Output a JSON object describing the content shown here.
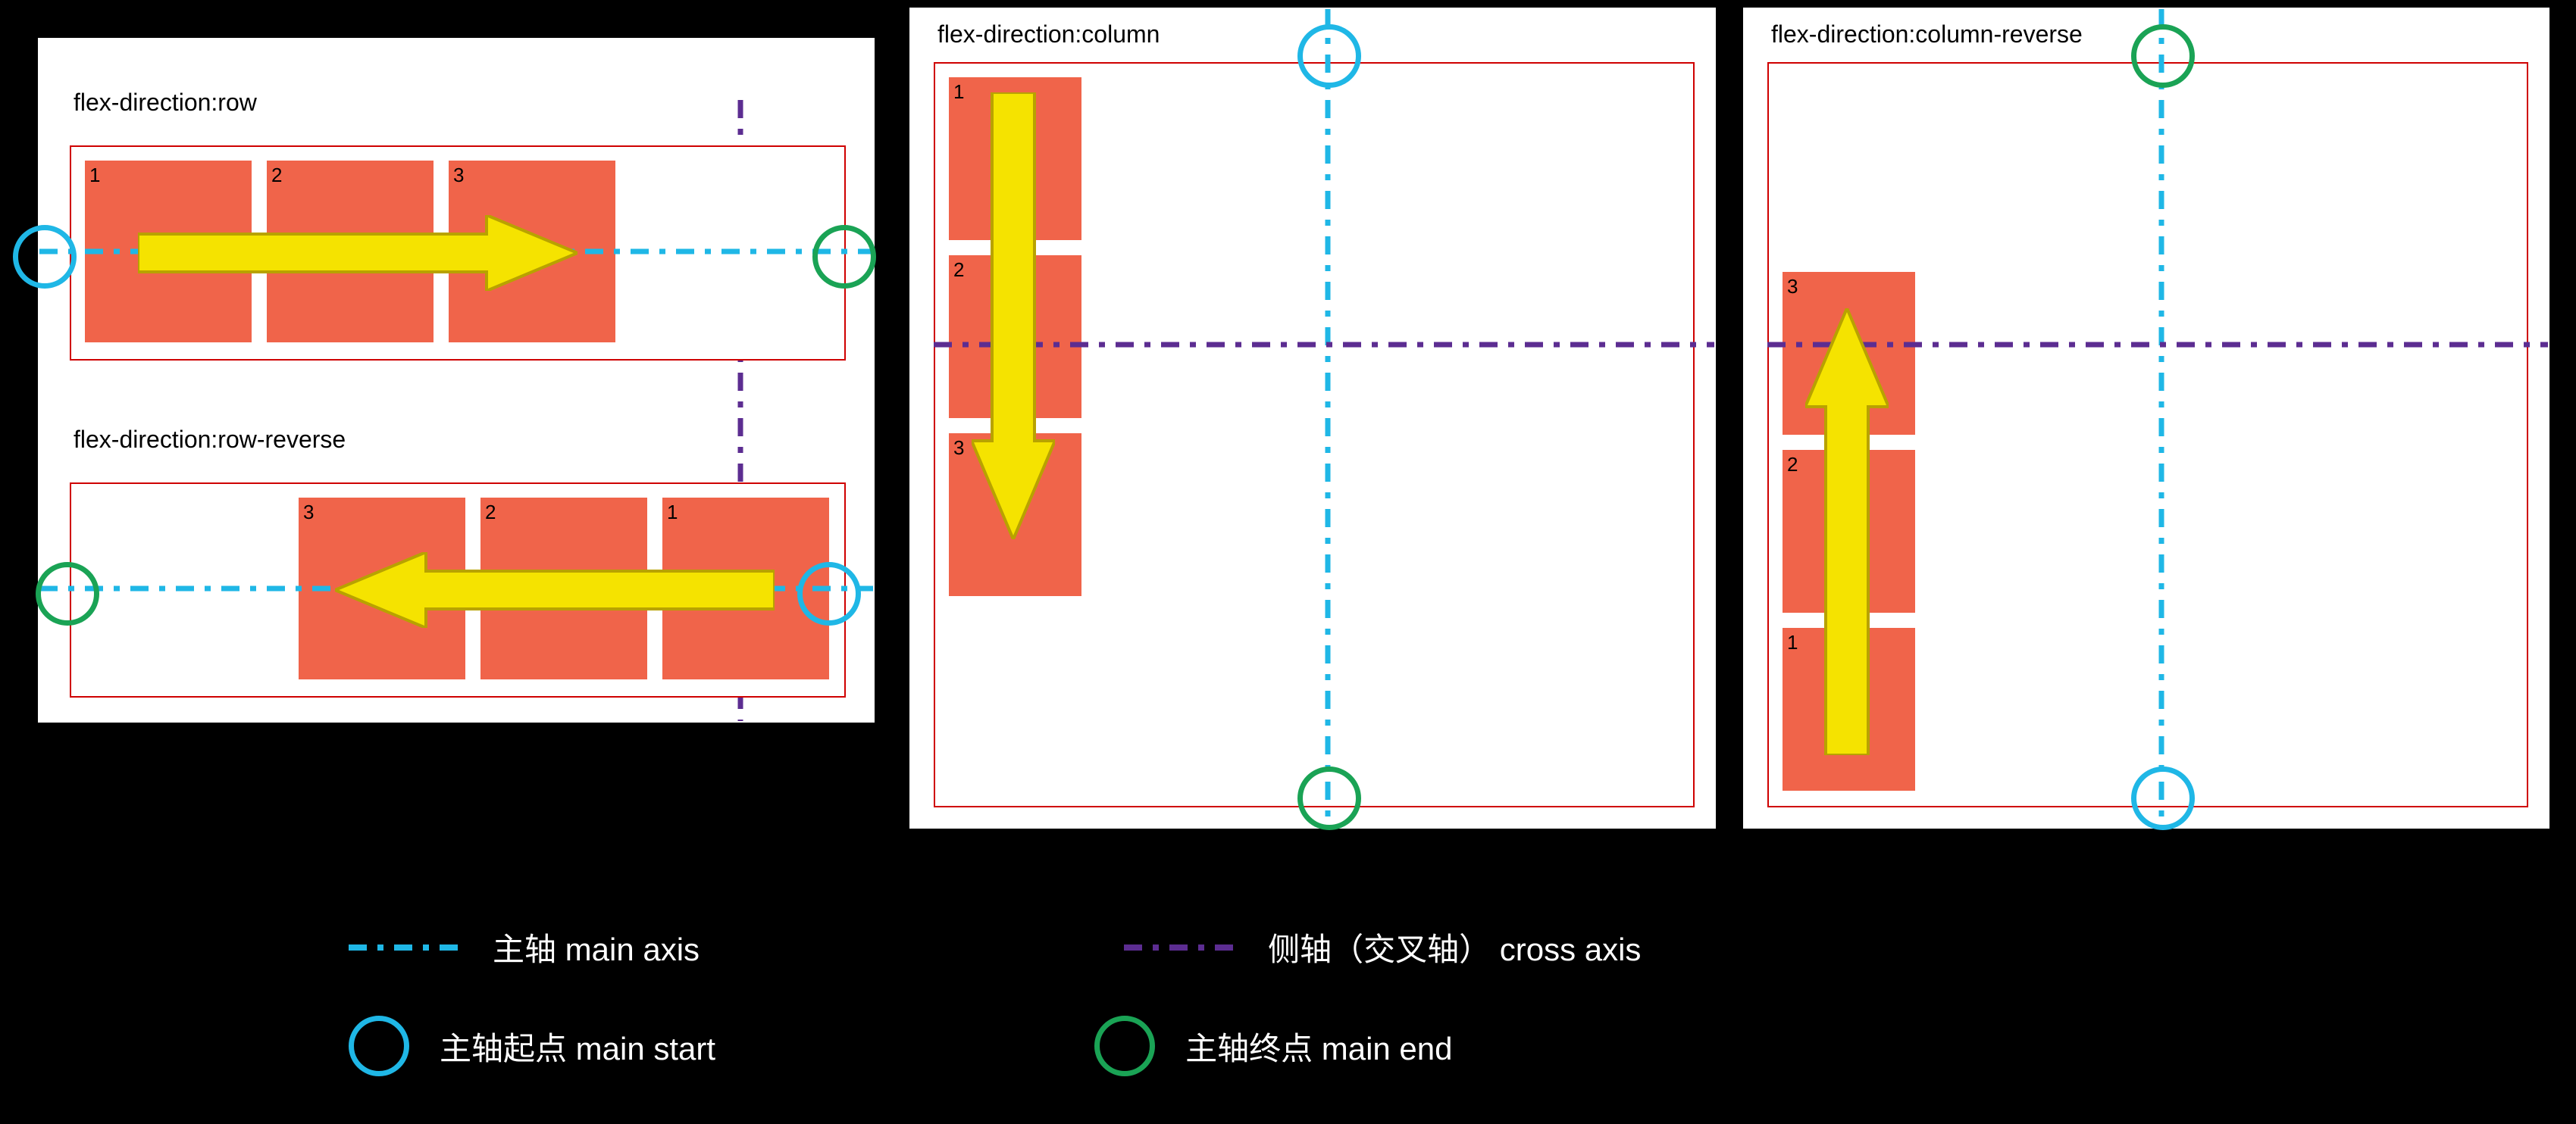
{
  "panels": {
    "rowPair": {
      "row": {
        "title": "flex-direction:row",
        "items": [
          "1",
          "2",
          "3"
        ]
      },
      "rowReverse": {
        "title": "flex-direction:row-reverse",
        "items": [
          "1",
          "2",
          "3"
        ]
      }
    },
    "column": {
      "title": "flex-direction:column",
      "items": [
        "1",
        "2",
        "3"
      ]
    },
    "columnReverse": {
      "title": "flex-direction:column-reverse",
      "items": [
        "1",
        "2",
        "3"
      ]
    }
  },
  "legend": {
    "mainAxis": "主轴 main axis",
    "crossAxis": "侧轴（交叉轴） cross axis",
    "mainStart": "主轴起点 main start",
    "mainEnd": "主轴终点 main end"
  },
  "colors": {
    "mainAxis": "#1fb7e6",
    "crossAxis": "#5c2d91",
    "mainStart": "#1fb7e6",
    "mainEnd": "#1aa355",
    "item": "#f0644a",
    "arrow": "#f5e300"
  },
  "chart_data": {
    "type": "diagram",
    "title": "CSS flex-direction values and their main/cross axes",
    "concepts": [
      {
        "value": "row",
        "item_order_visual": [
          "1",
          "2",
          "3"
        ],
        "main_axis": "horizontal",
        "main_axis_direction": "left-to-right",
        "cross_axis": "vertical",
        "main_start": "left",
        "main_end": "right"
      },
      {
        "value": "row-reverse",
        "item_order_visual": [
          "3",
          "2",
          "1"
        ],
        "main_axis": "horizontal",
        "main_axis_direction": "right-to-left",
        "cross_axis": "vertical",
        "main_start": "right",
        "main_end": "left"
      },
      {
        "value": "column",
        "item_order_visual": [
          "1",
          "2",
          "3"
        ],
        "main_axis": "vertical",
        "main_axis_direction": "top-to-bottom",
        "cross_axis": "horizontal",
        "main_start": "top",
        "main_end": "bottom"
      },
      {
        "value": "column-reverse",
        "item_order_visual": [
          "3",
          "2",
          "1"
        ],
        "main_axis": "vertical",
        "main_axis_direction": "bottom-to-top",
        "cross_axis": "horizontal",
        "main_start": "bottom",
        "main_end": "top"
      }
    ],
    "legend": {
      "main_axis_line_color": "#1fb7e6",
      "cross_axis_line_color": "#5c2d91",
      "main_start_circle_color": "#1fb7e6",
      "main_end_circle_color": "#1aa355"
    }
  }
}
